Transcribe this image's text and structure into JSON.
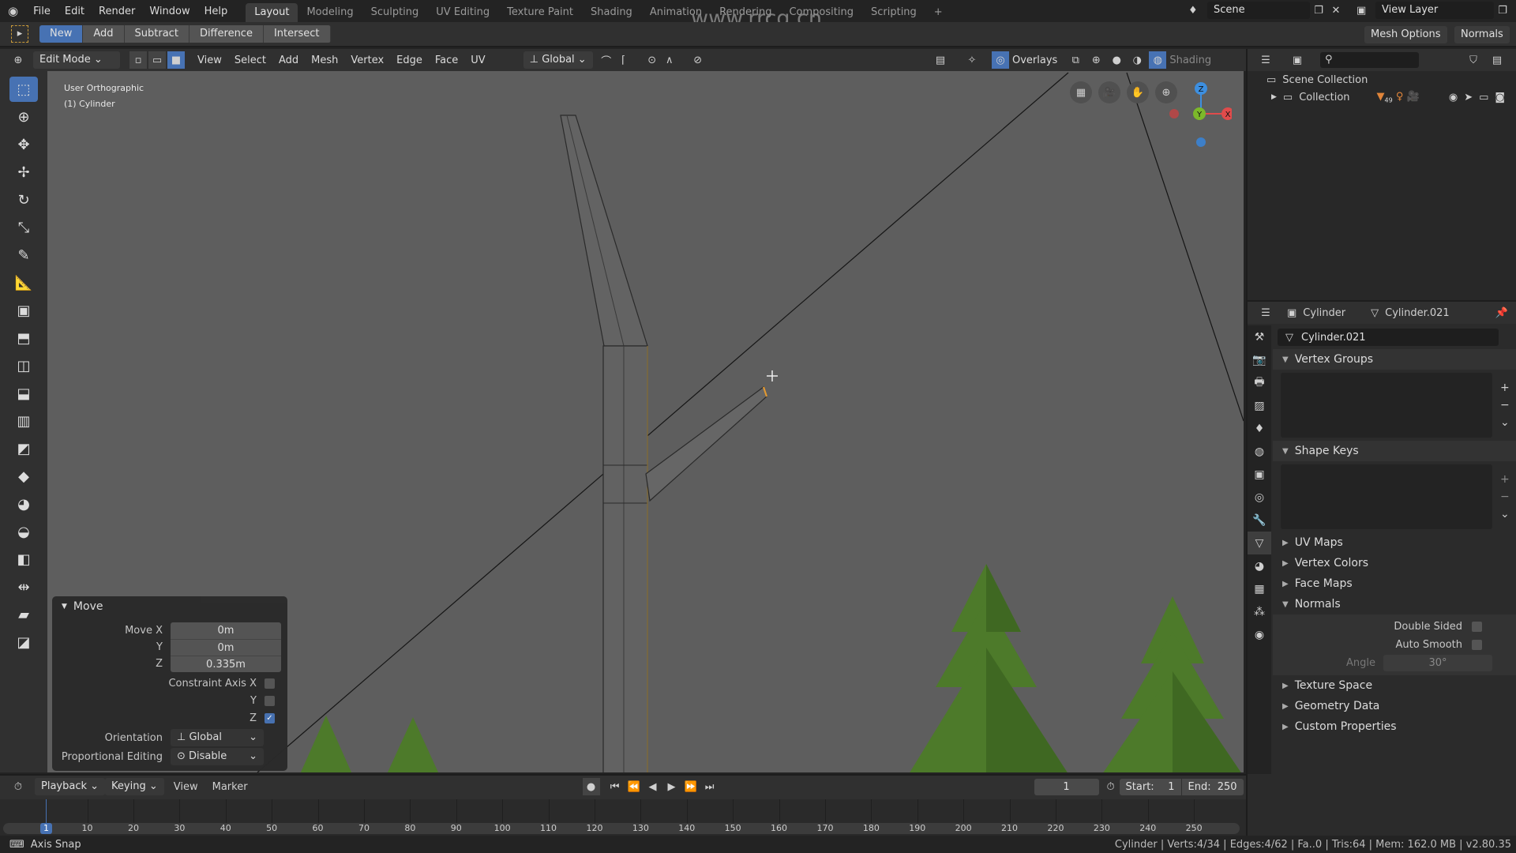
{
  "topbar": {
    "menus": [
      "File",
      "Edit",
      "Render",
      "Window",
      "Help"
    ],
    "workspaces": [
      "Layout",
      "Modeling",
      "Sculpting",
      "UV Editing",
      "Texture Paint",
      "Shading",
      "Animation",
      "Rendering",
      "Compositing",
      "Scripting"
    ],
    "active_workspace": "Layout",
    "add_tab": "+",
    "scene": "Scene",
    "view_layer": "View Layer",
    "watermark": "www.rrcg.cn"
  },
  "toolheader": {
    "modes": [
      "New",
      "Add",
      "Subtract",
      "Difference",
      "Intersect"
    ],
    "active_mode": "New",
    "mesh_options": "Mesh Options",
    "normals": "Normals"
  },
  "viewport_header": {
    "mode": "Edit Mode",
    "menus": [
      "View",
      "Select",
      "Add",
      "Mesh",
      "Vertex",
      "Edge",
      "Face",
      "UV"
    ],
    "orientation": "Global",
    "overlays": "Overlays",
    "shading": "Shading"
  },
  "viewport": {
    "view_name": "User Orthographic",
    "object_name": "(1) Cylinder",
    "gizmo": {
      "x": "X",
      "y": "Y",
      "z": "Z"
    },
    "colors": {
      "background": "#5e5e5e",
      "tree": "#4d7a2a",
      "x_axis": "#e04b4b",
      "y_axis": "#7cb82a",
      "z_axis": "#3d8fe0"
    }
  },
  "left_toolbar": {
    "tools": [
      "select-box",
      "cursor",
      "move",
      "move-axis",
      "rotate",
      "scale",
      "annotate",
      "measure",
      "add-cube",
      "extrude",
      "inset",
      "bevel",
      "loop-cut",
      "knife",
      "poly-build",
      "spin",
      "smooth",
      "edge-slide",
      "shrink-fatten",
      "shear",
      "rip"
    ],
    "active": "select-box"
  },
  "move_panel": {
    "title": "Move",
    "move_x_label": "Move X",
    "move_x": "0m",
    "y_label": "Y",
    "move_y": "0m",
    "z_label": "Z",
    "move_z": "0.335m",
    "constraint_label": "Constraint Axis X",
    "constraint_y_label": "Y",
    "constraint_z_label": "Z",
    "constraint": {
      "x": false,
      "y": false,
      "z": true
    },
    "orientation_label": "Orientation",
    "orientation": "Global",
    "proportional_label": "Proportional Editing",
    "proportional": "Disable"
  },
  "outliner": {
    "scene_collection": "Scene Collection",
    "collection": "Collection",
    "collection_badge": "49"
  },
  "properties": {
    "object": "Cylinder",
    "mesh": "Cylinder.021",
    "mesh_field": "Cylinder.021",
    "vertex_groups": "Vertex Groups",
    "shape_keys": "Shape Keys",
    "collapsed": [
      "UV Maps",
      "Vertex Colors",
      "Face Maps"
    ],
    "normals": "Normals",
    "double_sided": "Double Sided",
    "auto_smooth": "Auto Smooth",
    "angle_label": "Angle",
    "angle": "30°",
    "after": [
      "Texture Space",
      "Geometry Data",
      "Custom Properties"
    ]
  },
  "timeline": {
    "menus": [
      "Playback",
      "Keying",
      "View",
      "Marker"
    ],
    "current_frame": "1",
    "start_label": "Start:",
    "start": "1",
    "end_label": "End:",
    "end": "250",
    "ticks": [
      "10",
      "20",
      "30",
      "40",
      "50",
      "60",
      "70",
      "80",
      "90",
      "100",
      "110",
      "120",
      "130",
      "140",
      "150",
      "160",
      "170",
      "180",
      "190",
      "200",
      "210",
      "220",
      "230",
      "240",
      "250"
    ],
    "playhead": "1"
  },
  "statusbar": {
    "left": "Axis Snap",
    "right": "Cylinder | Verts:4/34 | Edges:4/62 | Fa..0 | Tris:64 | Mem: 162.0 MB | v2.80.35"
  }
}
